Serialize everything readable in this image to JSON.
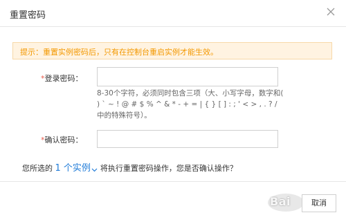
{
  "dialog": {
    "title": "重置密码",
    "notice": "提示：重置实例密码后，只有在控制台重启实例才能生效。"
  },
  "form": {
    "login_password": {
      "required_mark": "*",
      "label": "登录密码：",
      "value": "",
      "help": "8-30个字符，必须同时包含三项（大、小写字母，数字和( ) ` ~ ! @ # $ % ^ & * - + = | { } [ ] : ; ' < > , . ? / 中的特殊符号）。"
    },
    "confirm_password": {
      "required_mark": "*",
      "label": "确认密码：",
      "value": ""
    }
  },
  "confirm_line": {
    "prefix": "您所选的",
    "link": "1 个实例",
    "suffix": "将执行重置密码操作，您是否确认操作？"
  },
  "footer": {
    "cancel_label": "取消"
  },
  "watermark": {
    "text": "Bai"
  },
  "colors": {
    "notice_text": "#f39800",
    "notice_bg": "#fff3e1",
    "link": "#1f7bd8",
    "required": "#e85a4a"
  },
  "icons": {
    "close": "close-icon",
    "dropdown": "chevron-down-icon"
  }
}
